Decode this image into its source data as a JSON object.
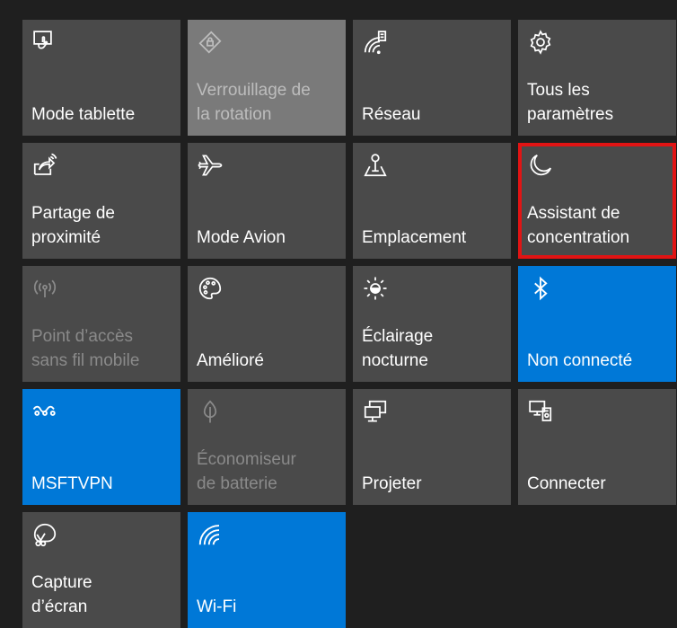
{
  "tiles": [
    {
      "id": "tablet-mode",
      "label": "Mode tablette",
      "icon": "tablet-mode-icon",
      "state": "off"
    },
    {
      "id": "rotation-lock",
      "label": "Verrouillage de\nla rotation",
      "icon": "rotation-lock-icon",
      "state": "unavailable"
    },
    {
      "id": "network",
      "label": "Réseau",
      "icon": "network-icon",
      "state": "off"
    },
    {
      "id": "all-settings",
      "label": "Tous les\nparamètres",
      "icon": "gear-icon",
      "state": "off"
    },
    {
      "id": "nearby-sharing",
      "label": "Partage de\nproximité",
      "icon": "share-icon",
      "state": "off"
    },
    {
      "id": "airplane-mode",
      "label": "Mode Avion",
      "icon": "airplane-icon",
      "state": "off"
    },
    {
      "id": "location",
      "label": "Emplacement",
      "icon": "location-icon",
      "state": "off"
    },
    {
      "id": "focus-assist",
      "label": "Assistant de\nconcentration",
      "icon": "moon-icon",
      "state": "off",
      "highlighted": true
    },
    {
      "id": "mobile-hotspot",
      "label": "Point d’accès\nsans fil mobile",
      "icon": "hotspot-icon",
      "state": "disabled"
    },
    {
      "id": "improved",
      "label": "Amélioré",
      "icon": "palette-icon",
      "state": "off"
    },
    {
      "id": "night-light",
      "label": "Éclairage\nnocturne",
      "icon": "brightness-icon",
      "state": "off"
    },
    {
      "id": "bluetooth",
      "label": "Non connecté",
      "icon": "bluetooth-icon",
      "state": "on"
    },
    {
      "id": "vpn",
      "label": "MSFTVPN",
      "icon": "vpn-icon",
      "state": "on"
    },
    {
      "id": "battery-saver",
      "label": "Économiseur\nde batterie",
      "icon": "leaf-icon",
      "state": "disabled"
    },
    {
      "id": "project",
      "label": "Projeter",
      "icon": "project-icon",
      "state": "off"
    },
    {
      "id": "connect",
      "label": "Connecter",
      "icon": "connect-icon",
      "state": "off"
    },
    {
      "id": "screen-snip",
      "label": "Capture\nd’écran",
      "icon": "snip-icon",
      "state": "off"
    },
    {
      "id": "wifi",
      "label": "Wi-Fi",
      "icon": "wifi-icon",
      "state": "on"
    }
  ],
  "colors": {
    "background": "#1f1f1f",
    "tile": "#4a4a4a",
    "tile_active": "#0078d7",
    "tile_unavailable": "#7a7a7a",
    "highlight": "#e11414"
  }
}
